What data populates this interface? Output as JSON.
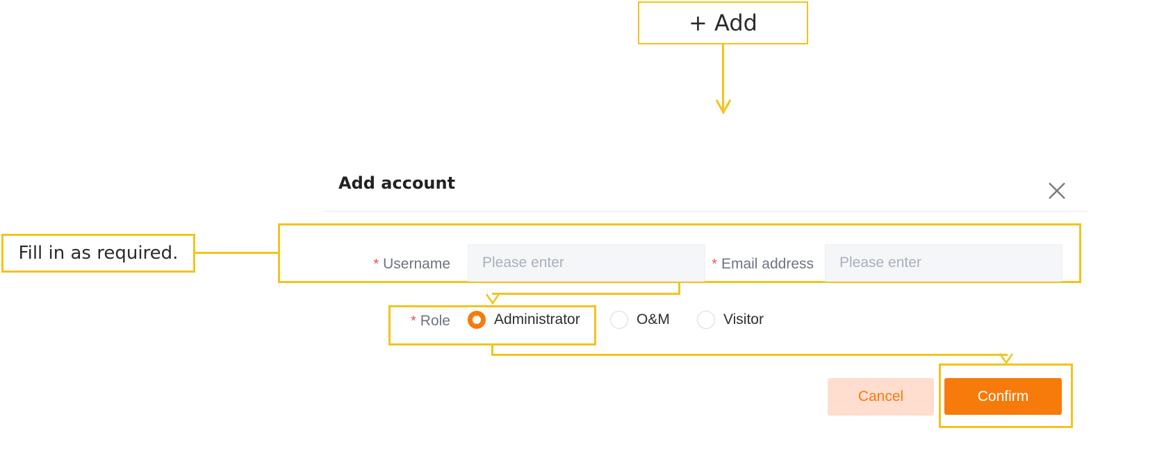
{
  "callouts": {
    "add_label": "+ Add",
    "fill_note": "Fill in as required."
  },
  "dialog": {
    "title": "Add account",
    "fields": {
      "username": {
        "label": "Username",
        "placeholder": "Please enter",
        "value": ""
      },
      "email": {
        "label": "Email address",
        "placeholder": "Please enter",
        "value": ""
      }
    },
    "role": {
      "label": "Role",
      "options": [
        {
          "label": "Administrator",
          "selected": true
        },
        {
          "label": "O&M",
          "selected": false
        },
        {
          "label": "Visitor",
          "selected": false
        }
      ]
    },
    "buttons": {
      "cancel": "Cancel",
      "confirm": "Confirm"
    }
  },
  "colors": {
    "accent": "#F77B0B",
    "annotation": "#F5C21B",
    "required_mark": "#F04F4F",
    "cancel_bg": "#FFDDCF"
  },
  "icons": {
    "close": "close-icon",
    "required": "asterisk-icon"
  },
  "required_mark": "*"
}
